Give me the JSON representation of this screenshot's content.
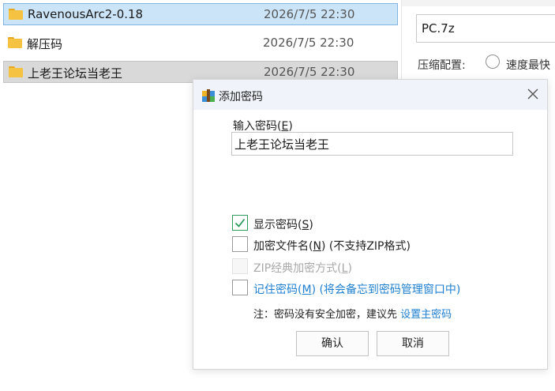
{
  "files": [
    {
      "name": "RavenousArc2-0.18",
      "date": "2026/7/5 22:30",
      "state": "selected"
    },
    {
      "name": "解压码",
      "date": "2026/7/5 22:30",
      "state": "normal"
    },
    {
      "name": "上老王论坛当老王",
      "date": "2026/7/5 22:30",
      "state": "hover"
    }
  ],
  "settings": {
    "archive_name": "PC.7z",
    "compress_label": "压缩配置:",
    "speed_option": "速度最快"
  },
  "dialog": {
    "title": "添加密码",
    "password_label": "输入密码(",
    "password_key": "E",
    "password_label_end": ")",
    "password_value": "上老王论坛当老王",
    "show_password": {
      "label": "显示密码(",
      "key": "S",
      "end": ")"
    },
    "encrypt_filenames": {
      "label": "加密文件名(",
      "key": "N",
      "end": ") (不支持ZIP格式)"
    },
    "zip_classic": {
      "label": "ZIP经典加密方式(",
      "key": "L",
      "end": ")"
    },
    "remember_password": {
      "label": "记住密码(",
      "key": "M",
      "end": ") (将会备忘到密码管理窗口中)"
    },
    "note_text": "注：密码没有安全加密，建议先 ",
    "note_link": "设置主密码",
    "ok_label": "确认",
    "cancel_label": "取消"
  },
  "colors": {
    "selected_row": "#cce4f7",
    "hover_row": "#d9d9d9",
    "link": "#1f7fd1",
    "check": "#2e9b5c",
    "folder": "#f5c242"
  }
}
